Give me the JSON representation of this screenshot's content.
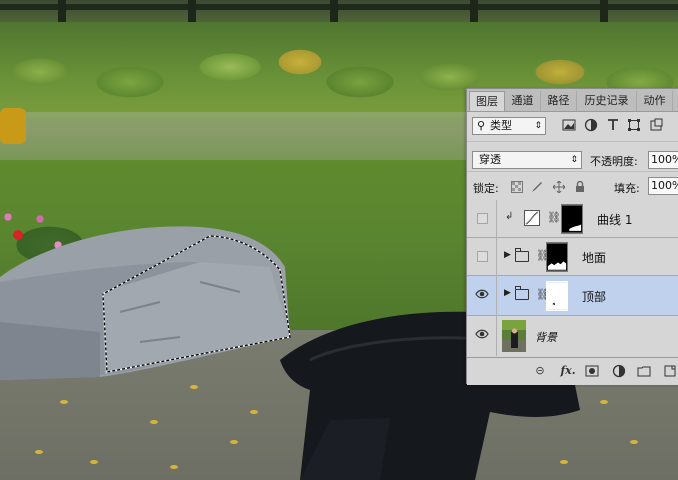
{
  "photo": {
    "description_icons": [
      "photo-background"
    ]
  },
  "layers_panel": {
    "tabs": [
      {
        "label": "图层",
        "active": true
      },
      {
        "label": "通道",
        "active": false
      },
      {
        "label": "路径",
        "active": false
      },
      {
        "label": "历史记录",
        "active": false
      },
      {
        "label": "动作",
        "active": false
      }
    ],
    "filter": {
      "kind_label": "类型",
      "icons": [
        "pixel-filter-icon",
        "adjustment-filter-icon",
        "type-filter-icon",
        "shape-filter-icon",
        "smart-object-filter-icon"
      ]
    },
    "blend_mode": "穿透",
    "opacity_label": "不透明度:",
    "opacity_value": "100%",
    "lock_label": "锁定:",
    "lock_icons": [
      "lock-transparent-icon",
      "lock-paint-icon",
      "lock-move-icon",
      "lock-all-icon"
    ],
    "fill_label": "填充:",
    "fill_value": "100%",
    "layers": [
      {
        "name": "曲线 1",
        "visible": false,
        "type": "adjustment"
      },
      {
        "name": "地面",
        "visible": false,
        "type": "group"
      },
      {
        "name": "顶部",
        "visible": true,
        "type": "group",
        "selected": true
      },
      {
        "name": "背景",
        "visible": true,
        "type": "background"
      }
    ],
    "footer_icons": [
      "link-layers-icon",
      "fx-icon",
      "add-mask-icon",
      "new-adjustment-icon",
      "new-group-icon",
      "new-layer-icon"
    ],
    "fx_label": "fx."
  }
}
